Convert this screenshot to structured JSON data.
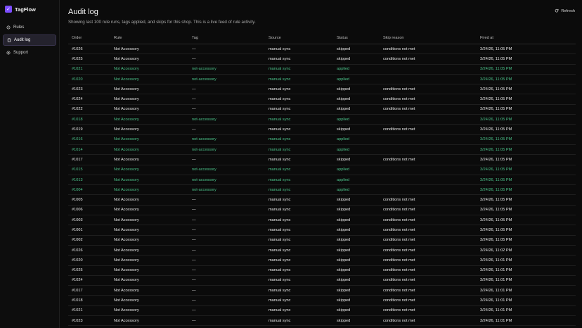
{
  "brand": {
    "name": "TagFlow",
    "logo_glyph": "✓",
    "accent": "#7c4dff"
  },
  "sidebar": {
    "items": [
      {
        "label": "Rules",
        "icon": "rules-icon",
        "active": false
      },
      {
        "label": "Audit log",
        "icon": "clipboard-icon",
        "active": true
      },
      {
        "label": "Support",
        "icon": "support-icon",
        "active": false
      }
    ]
  },
  "page": {
    "title": "Audit log",
    "description": "Showing last 100 rule runs, tags applied, and skips for this shop. This is a live feed of rule activity.",
    "refresh_label": "Refresh"
  },
  "colors": {
    "applied": "#4cc38a"
  },
  "table": {
    "headers": [
      "Order",
      "Rule",
      "Tag",
      "Source",
      "Status",
      "Skip reason",
      "Fired at"
    ],
    "rows": [
      [
        "#1026",
        "Not Accessory",
        "—",
        "manual sync",
        "skipped",
        "conditions not met",
        "3/24/26, 11:05 PM"
      ],
      [
        "#1025",
        "Not Accessory",
        "—",
        "manual sync",
        "skipped",
        "conditions not met",
        "3/24/26, 11:05 PM"
      ],
      [
        "#1021",
        "Not Accessory",
        "not-accessory",
        "manual sync",
        "applied",
        "",
        "3/24/26, 11:05 PM"
      ],
      [
        "#1020",
        "Not Accessory",
        "not-accessory",
        "manual sync",
        "applied",
        "",
        "3/24/26, 11:05 PM"
      ],
      [
        "#1023",
        "Not Accessory",
        "—",
        "manual sync",
        "skipped",
        "conditions not met",
        "3/24/26, 11:05 PM"
      ],
      [
        "#1024",
        "Not Accessory",
        "—",
        "manual sync",
        "skipped",
        "conditions not met",
        "3/24/26, 11:05 PM"
      ],
      [
        "#1022",
        "Not Accessory",
        "—",
        "manual sync",
        "skipped",
        "conditions not met",
        "3/24/26, 11:05 PM"
      ],
      [
        "#1018",
        "Not Accessory",
        "not-accessory",
        "manual sync",
        "applied",
        "",
        "3/24/26, 11:05 PM"
      ],
      [
        "#1019",
        "Not Accessory",
        "—",
        "manual sync",
        "skipped",
        "conditions not met",
        "3/24/26, 11:05 PM"
      ],
      [
        "#1016",
        "Not Accessory",
        "not-accessory",
        "manual sync",
        "applied",
        "",
        "3/24/26, 11:05 PM"
      ],
      [
        "#1014",
        "Not Accessory",
        "not-accessory",
        "manual sync",
        "applied",
        "",
        "3/24/26, 11:05 PM"
      ],
      [
        "#1017",
        "Not Accessory",
        "—",
        "manual sync",
        "skipped",
        "conditions not met",
        "3/24/26, 11:05 PM"
      ],
      [
        "#1015",
        "Not Accessory",
        "not-accessory",
        "manual sync",
        "applied",
        "",
        "3/24/26, 11:05 PM"
      ],
      [
        "#1013",
        "Not Accessory",
        "not-accessory",
        "manual sync",
        "applied",
        "",
        "3/24/26, 11:05 PM"
      ],
      [
        "#1004",
        "Not Accessory",
        "not-accessory",
        "manual sync",
        "applied",
        "",
        "3/24/26, 11:05 PM"
      ],
      [
        "#1005",
        "Not Accessory",
        "—",
        "manual sync",
        "skipped",
        "conditions not met",
        "3/24/26, 11:05 PM"
      ],
      [
        "#1006",
        "Not Accessory",
        "—",
        "manual sync",
        "skipped",
        "conditions not met",
        "3/24/26, 11:05 PM"
      ],
      [
        "#1003",
        "Not Accessory",
        "—",
        "manual sync",
        "skipped",
        "conditions not met",
        "3/24/26, 11:05 PM"
      ],
      [
        "#1001",
        "Not Accessory",
        "—",
        "manual sync",
        "skipped",
        "conditions not met",
        "3/24/26, 11:05 PM"
      ],
      [
        "#1002",
        "Not Accessory",
        "—",
        "manual sync",
        "skipped",
        "conditions not met",
        "3/24/26, 11:05 PM"
      ],
      [
        "#1026",
        "Not Accessory",
        "—",
        "manual sync",
        "skipped",
        "conditions not met",
        "3/24/26, 11:02 PM"
      ],
      [
        "#1020",
        "Not Accessory",
        "—",
        "manual sync",
        "skipped",
        "conditions not met",
        "3/24/26, 11:01 PM"
      ],
      [
        "#1025",
        "Not Accessory",
        "—",
        "manual sync",
        "skipped",
        "conditions not met",
        "3/24/26, 11:01 PM"
      ],
      [
        "#1024",
        "Not Accessory",
        "—",
        "manual sync",
        "skipped",
        "conditions not met",
        "3/24/26, 11:01 PM"
      ],
      [
        "#1017",
        "Not Accessory",
        "—",
        "manual sync",
        "skipped",
        "conditions not met",
        "3/24/26, 11:01 PM"
      ],
      [
        "#1018",
        "Not Accessory",
        "—",
        "manual sync",
        "skipped",
        "conditions not met",
        "3/24/26, 11:01 PM"
      ],
      [
        "#1021",
        "Not Accessory",
        "—",
        "manual sync",
        "skipped",
        "conditions not met",
        "3/24/26, 11:01 PM"
      ],
      [
        "#1023",
        "Not Accessory",
        "—",
        "manual sync",
        "skipped",
        "conditions not met",
        "3/24/26, 11:01 PM"
      ]
    ]
  }
}
